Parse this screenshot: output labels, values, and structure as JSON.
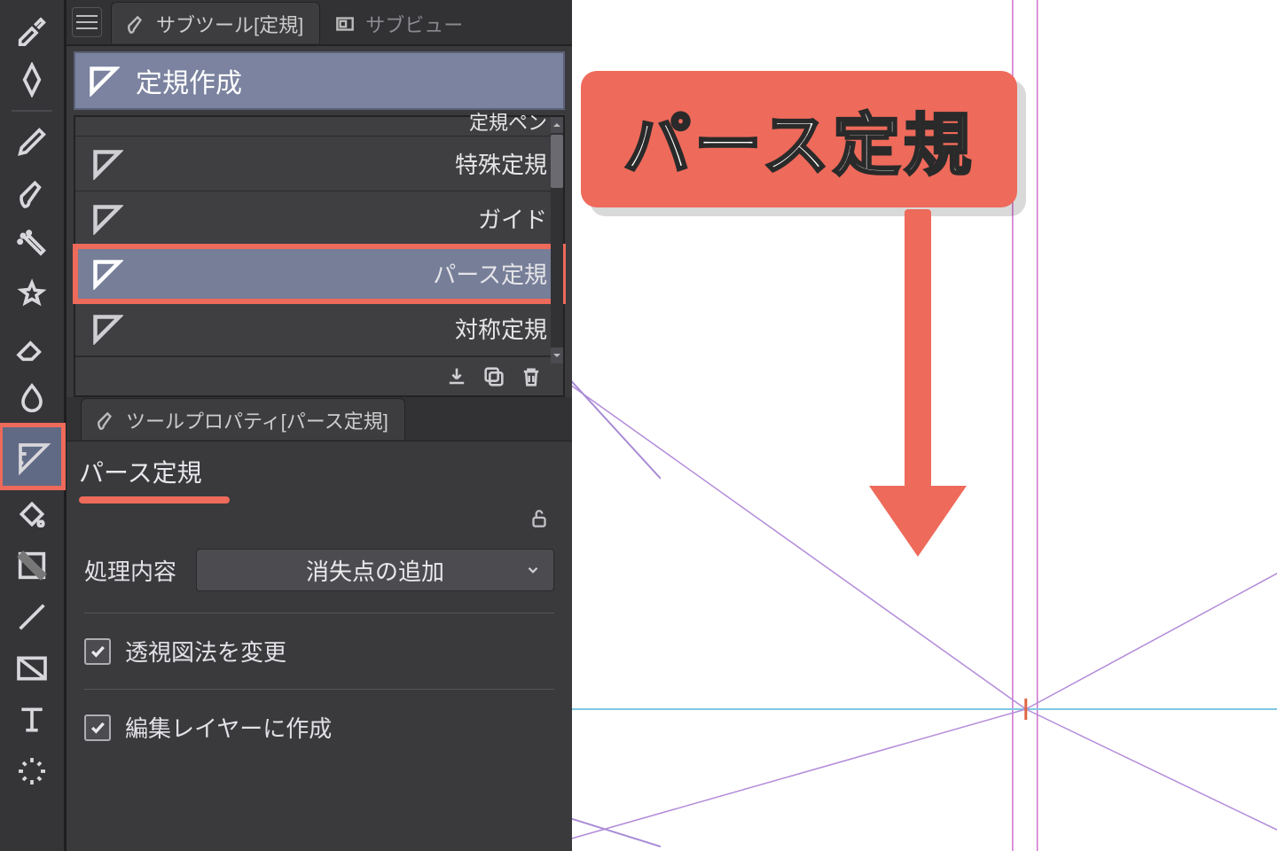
{
  "callout": {
    "title": "パース定規"
  },
  "toolbar": {
    "tools": [
      {
        "name": "eyedropper"
      },
      {
        "name": "correct-line"
      },
      {
        "name": "pen"
      },
      {
        "name": "brush"
      },
      {
        "name": "airbrush"
      },
      {
        "name": "decoration"
      },
      {
        "name": "eraser"
      },
      {
        "name": "blend"
      },
      {
        "name": "ruler",
        "active": true
      },
      {
        "name": "fill"
      },
      {
        "name": "gradient"
      },
      {
        "name": "line"
      },
      {
        "name": "frame"
      },
      {
        "name": "text"
      },
      {
        "name": "light"
      }
    ]
  },
  "subtool_panel": {
    "tabs": {
      "active": "サブツール[定規]",
      "inactive": "サブビュー"
    },
    "group": "定規作成",
    "items": [
      {
        "label": "定規ペン",
        "cut": true
      },
      {
        "label": "特殊定規"
      },
      {
        "label": "ガイド"
      },
      {
        "label": "パース定規",
        "selected": true
      },
      {
        "label": "対称定規"
      }
    ],
    "actions": {
      "download": "download-icon",
      "duplicate": "duplicate-icon",
      "delete": "trash-icon"
    }
  },
  "tool_property": {
    "tab": "ツールプロパティ[パース定規]",
    "title": "パース定規",
    "process_label": "処理内容",
    "process_value": "消失点の追加",
    "checkbox1": "透視図法を変更",
    "checkbox2": "編集レイヤーに作成"
  }
}
